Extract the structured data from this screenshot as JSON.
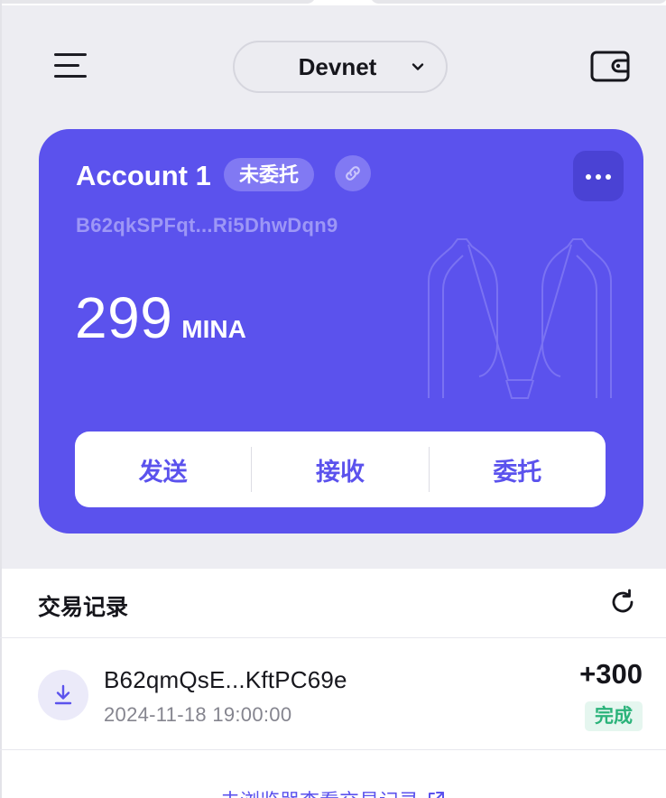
{
  "header": {
    "menu_icon": "menu-icon",
    "network": "Devnet",
    "wallet_icon": "wallet-icon"
  },
  "account": {
    "name": "Account 1",
    "delegation_status": "未委托",
    "address": "B62qkSPFqt...Ri5DhwDqn9",
    "balance": "299",
    "unit": "MINA",
    "link_icon": "link-icon",
    "more_icon": "more-horizontal-icon",
    "card_color": "#5b52ed",
    "actions": [
      {
        "label": "发送"
      },
      {
        "label": "接收"
      },
      {
        "label": "委托"
      }
    ]
  },
  "transactions": {
    "title": "交易记录",
    "refresh_icon": "refresh-icon",
    "items": [
      {
        "icon": "receive-icon",
        "address": "B62qmQsE...KftPC69e",
        "time": "2024-11-18 19:00:00",
        "amount": "+300",
        "status": "完成"
      }
    ],
    "explorer_link": "去浏览器查看交易记录",
    "explorer_icon": "external-link-icon"
  },
  "colors": {
    "accent": "#5b52ed",
    "success": "#2bb37a"
  }
}
